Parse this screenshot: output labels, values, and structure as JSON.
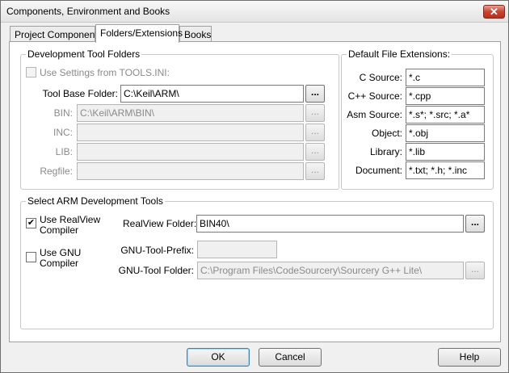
{
  "window": {
    "title": "Components, Environment and Books",
    "close_glyph": "✕"
  },
  "tabs": [
    {
      "label": "Project Components"
    },
    {
      "label": "Folders/Extensions"
    },
    {
      "label": "Books"
    }
  ],
  "dev_folders": {
    "title": "Development Tool Folders",
    "use_settings_label": "Use Settings from TOOLS.INI:",
    "use_settings_checked": false,
    "tool_base_label": "Tool Base Folder:",
    "tool_base_value": "C:\\Keil\\ARM\\",
    "bin_label": "BIN:",
    "bin_value": "C:\\Keil\\ARM\\BIN\\",
    "inc_label": "INC:",
    "inc_value": "",
    "lib_label": "LIB:",
    "lib_value": "",
    "regfile_label": "Regfile:",
    "regfile_value": "",
    "browse_label": "..."
  },
  "extensions": {
    "title": "Default File Extensions:",
    "items": [
      {
        "label": "C Source:",
        "value": "*.c"
      },
      {
        "label": "C++ Source:",
        "value": "*.cpp"
      },
      {
        "label": "Asm Source:",
        "value": "*.s*; *.src; *.a*"
      },
      {
        "label": "Object:",
        "value": "*.obj"
      },
      {
        "label": "Library:",
        "value": "*.lib"
      },
      {
        "label": "Document:",
        "value": "*.txt; *.h; *.inc"
      }
    ]
  },
  "arm_tools": {
    "title": "Select ARM Development Tools",
    "realview_label_1": "Use RealView",
    "realview_label_2": "Compiler",
    "realview_checked": true,
    "gnu_label_1": "Use GNU",
    "gnu_label_2": "Compiler",
    "gnu_checked": false,
    "realview_folder_label": "RealView Folder:",
    "realview_folder_value": "BIN40\\",
    "gnu_prefix_label": "GNU-Tool-Prefix:",
    "gnu_prefix_value": "",
    "gnu_folder_label": "GNU-Tool Folder:",
    "gnu_folder_value": "C:\\Program Files\\CodeSourcery\\Sourcery G++ Lite\\",
    "check_glyph": "✔"
  },
  "buttons": {
    "ok": "OK",
    "cancel": "Cancel",
    "help": "Help"
  }
}
